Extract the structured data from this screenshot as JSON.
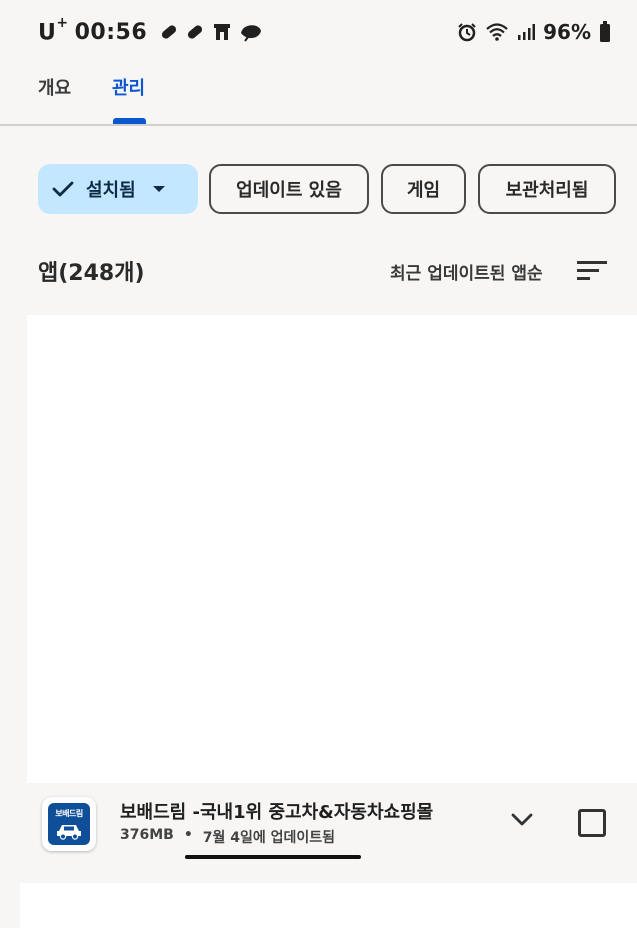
{
  "status_bar": {
    "carrier": "U",
    "carrier_sup": "+",
    "time": "00:56",
    "battery": "96%",
    "left_icons": [
      "pill-icon",
      "pill-icon",
      "store-icon",
      "leaf-icon"
    ],
    "right_icons": [
      "alarm-icon",
      "wifi-icon",
      "signal-icon",
      "battery-icon"
    ]
  },
  "tabs": [
    {
      "label": "개요",
      "active": false
    },
    {
      "label": "관리",
      "active": true
    }
  ],
  "filters": {
    "installed": "설치됨",
    "updates": "업데이트 있음",
    "games": "게임",
    "archived": "보관처리됨"
  },
  "list_header": {
    "count_label": "앱(248개)",
    "sort_label": "최근 업데이트된 앱순"
  },
  "app": {
    "name": "보배드림 -국내1위 중고차&자동차쇼핑몰",
    "size": "376MB",
    "separator": "•",
    "updated": "7월 4일에 업데이트됨",
    "icon_text": "보배드림"
  },
  "colors": {
    "accent": "#0b57d0",
    "chip_selected": "#c2e7ff",
    "app_icon": "#0f4f9a"
  }
}
